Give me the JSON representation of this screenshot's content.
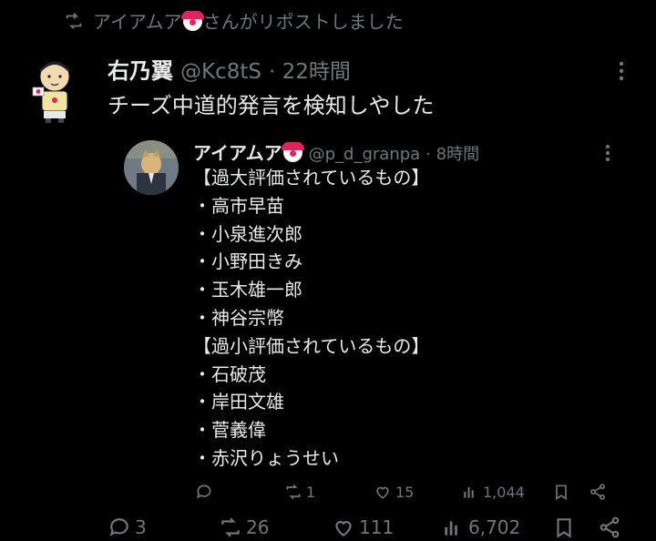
{
  "repost": {
    "icon": "repost-icon",
    "name": "アイアムア",
    "suffix": "さんがリポストしました"
  },
  "main_tweet": {
    "name": "右乃翼",
    "handle": "@Kc8tS",
    "time": "· 22時間",
    "text": "チーズ中道的発言を検知しやした"
  },
  "quote_tweet": {
    "name": "アイアムア",
    "handle": "@p_d_granpa",
    "time": "· 8時間",
    "lines": [
      "【過大評価されているもの】",
      "・高市早苗",
      "・小泉進次郎",
      "・小野田きみ",
      "・玉木雄一郎",
      "・神谷宗幣",
      "【過小評価されているもの】",
      "・石破茂",
      "・岸田文雄",
      "・菅義偉",
      "・赤沢りょうせい"
    ],
    "actions": {
      "reply": "",
      "repost": "1",
      "like": "15",
      "views": "1,044"
    }
  },
  "main_actions": {
    "reply": "3",
    "repost": "26",
    "like": "111",
    "views": "6,702"
  },
  "colors": {
    "background": "#000000",
    "text": "#e7e9ea",
    "muted": "#71767b"
  }
}
